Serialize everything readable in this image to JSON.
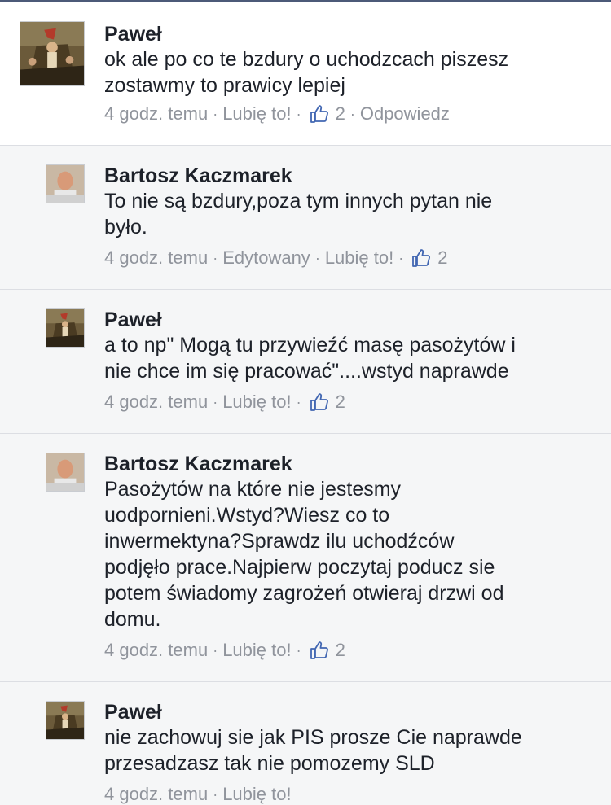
{
  "comments": [
    {
      "author": "Paweł",
      "lines": [
        "ok ale po co te bzdury o uchodzcach piszesz",
        "zostawmy to prawicy lepiej"
      ],
      "time": "4 godz. temu",
      "edited": "",
      "like": "Lubię to!",
      "like_count": "2",
      "reply": "Odpowiedz"
    },
    {
      "author": "Bartosz Kaczmarek",
      "lines": [
        "To nie są bzdury,poza tym innych pytan nie",
        "było."
      ],
      "time": "4 godz. temu",
      "edited": "Edytowany",
      "like": "Lubię to!",
      "like_count": "2"
    },
    {
      "author": "Paweł",
      "lines": [
        "a to np\" Mogą tu przywieźć masę pasożytów i",
        "nie chce im się pracować\"....wstyd naprawde"
      ],
      "time": "4 godz. temu",
      "like": "Lubię to!",
      "like_count": "2"
    },
    {
      "author": "Bartosz Kaczmarek",
      "lines": [
        "Pasożytów na które nie jestesmy",
        "uodpornieni.Wstyd?Wiesz co to",
        "inwermektyna?Sprawdz ilu uchodźców",
        "podjęło prace.Najpierw poczytaj poducz sie",
        "potem świadomy zagrożeń otwieraj drzwi od",
        "domu."
      ],
      "time": "4 godz. temu",
      "like": "Lubię to!",
      "like_count": "2"
    },
    {
      "author": "Paweł",
      "lines": [
        "nie zachowuj sie jak PIS prosze Cie naprawde",
        "przesadzasz tak nie pomozemy SLD"
      ],
      "time": "4 godz. temu",
      "like": "Lubię to!"
    }
  ],
  "separator": "·",
  "icons": {
    "like": "thumbs-up-icon",
    "avatar_pawel": "painting-avatar",
    "avatar_bartosz": "person-avatar"
  },
  "colors": {
    "meta": "#90949c",
    "like_icon": "#4267b2",
    "reply_bg": "#f5f6f7"
  }
}
